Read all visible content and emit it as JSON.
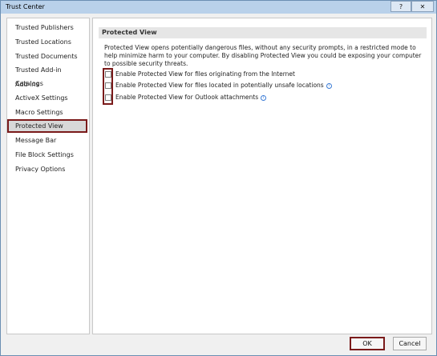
{
  "window": {
    "title": "Trust Center",
    "help_glyph": "?",
    "close_glyph": "✕"
  },
  "sidebar": {
    "items": [
      {
        "label": "Trusted Publishers"
      },
      {
        "label": "Trusted Locations"
      },
      {
        "label": "Trusted Documents"
      },
      {
        "label": "Trusted Add-in Catalogs"
      },
      {
        "label": "Add-ins"
      },
      {
        "label": "ActiveX Settings"
      },
      {
        "label": "Macro Settings"
      },
      {
        "label": "Protected View",
        "selected": true
      },
      {
        "label": "Message Bar"
      },
      {
        "label": "File Block Settings"
      },
      {
        "label": "Privacy Options"
      }
    ]
  },
  "main": {
    "section_title": "Protected View",
    "description": "Protected View opens potentially dangerous files, without any security prompts, in a restricted mode to help minimize harm to your computer. By disabling Protected View you could be exposing your computer to possible security threats.",
    "options": [
      {
        "label": "Enable Protected View for files originating from the Internet",
        "checked": false,
        "has_info": false
      },
      {
        "label": "Enable Protected View for files located in potentially unsafe locations",
        "checked": false,
        "has_info": true
      },
      {
        "label": "Enable Protected View for Outlook attachments",
        "checked": false,
        "has_info": true
      }
    ]
  },
  "footer": {
    "ok_label": "OK",
    "cancel_label": "Cancel"
  },
  "colors": {
    "highlight_border": "#7a1a1a",
    "titlebar": "#b9d1ea",
    "info_icon": "#3a7bd5"
  }
}
